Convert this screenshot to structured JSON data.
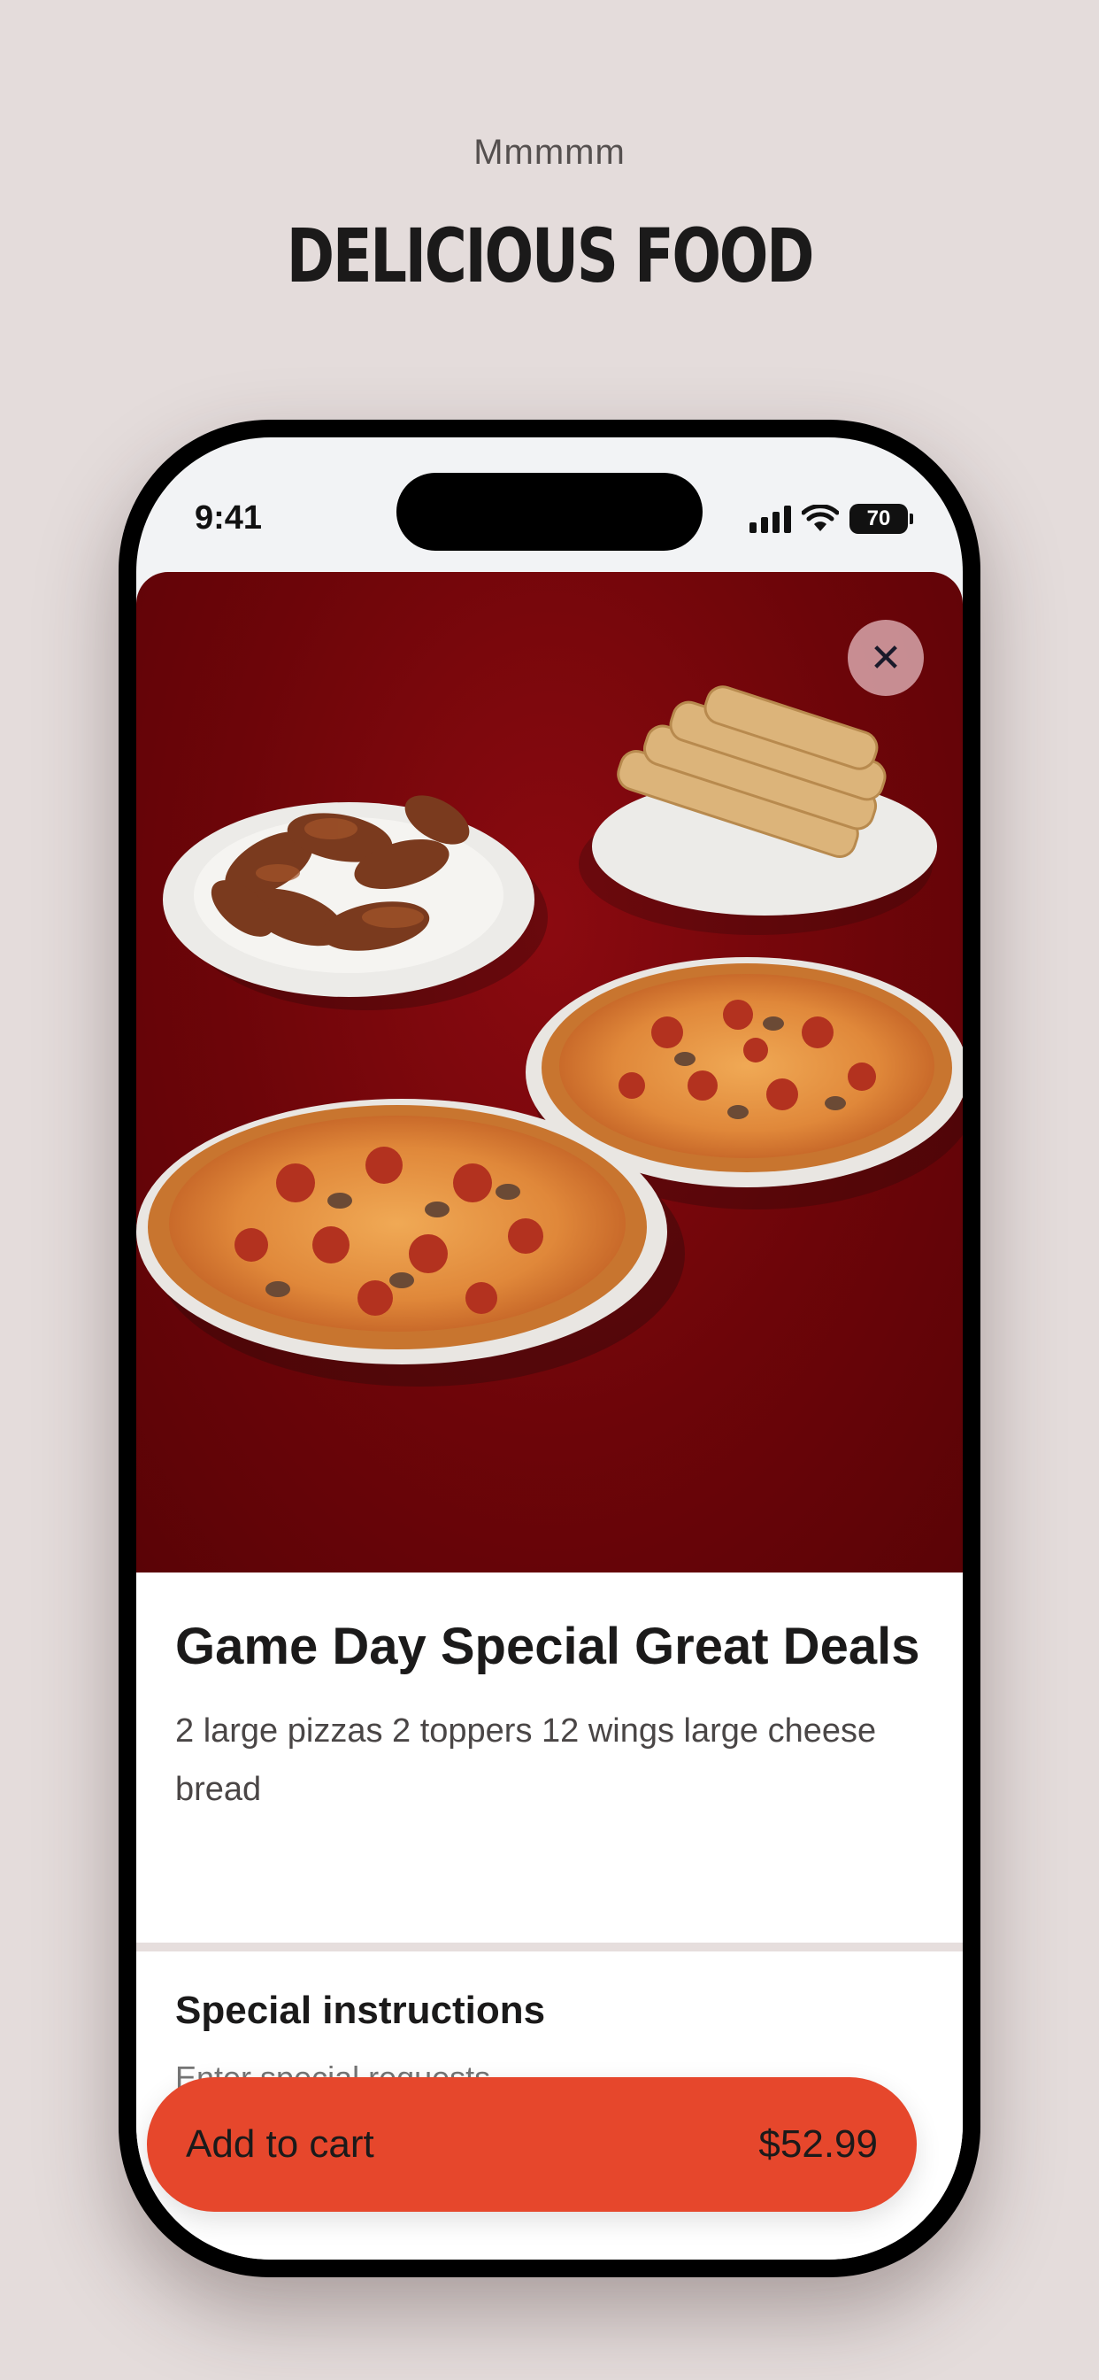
{
  "header": {
    "eyebrow": "Mmmmm",
    "title": "DELICIOUS FOOD"
  },
  "status_bar": {
    "time": "9:41",
    "battery": "70",
    "icons": [
      "signal-icon",
      "wifi-icon",
      "battery-icon"
    ]
  },
  "product": {
    "image": "Wings, cheese bread and two pepperoni mushroom pizzas on a dark red background",
    "title": "Game Day Special Great Deals",
    "description": "2 large pizzas 2 toppers 12 wings large cheese bread"
  },
  "instructions": {
    "label": "Special instructions",
    "placeholder": "Enter special requests"
  },
  "cart": {
    "label": "Add to cart",
    "price": "$52.99"
  },
  "colors": {
    "background": "#e4dcdb",
    "accent": "#e6472c",
    "hero": "#6d0509"
  }
}
